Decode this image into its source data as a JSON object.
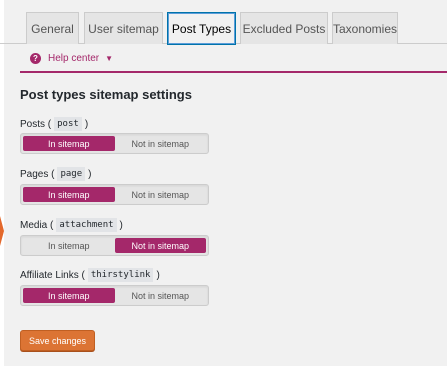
{
  "tabs": [
    {
      "label": "General",
      "active": false
    },
    {
      "label": "User sitemap",
      "active": false
    },
    {
      "label": "Post Types",
      "active": true
    },
    {
      "label": "Excluded Posts",
      "active": false
    },
    {
      "label": "Taxonomies",
      "active": false
    }
  ],
  "help": {
    "icon_glyph": "?",
    "label": "Help center",
    "caret": "▼"
  },
  "section_title": "Post types sitemap settings",
  "post_types": [
    {
      "label": "Posts (",
      "slug": "post",
      "close": ")",
      "options": [
        "In sitemap",
        "Not in sitemap"
      ],
      "selected": "In sitemap"
    },
    {
      "label": "Pages (",
      "slug": "page",
      "close": ")",
      "options": [
        "In sitemap",
        "Not in sitemap"
      ],
      "selected": "In sitemap"
    },
    {
      "label": "Media (",
      "slug": "attachment",
      "close": ")",
      "options": [
        "In sitemap",
        "Not in sitemap"
      ],
      "selected": "Not in sitemap"
    },
    {
      "label": "Affiliate Links (",
      "slug": "thirstylink",
      "close": ")",
      "options": [
        "In sitemap",
        "Not in sitemap"
      ],
      "selected": "In sitemap"
    }
  ],
  "save_label": "Save changes",
  "colors": {
    "accent": "#a4286a",
    "save_button": "#dc7434",
    "active_tab_border": "#0073aa"
  }
}
